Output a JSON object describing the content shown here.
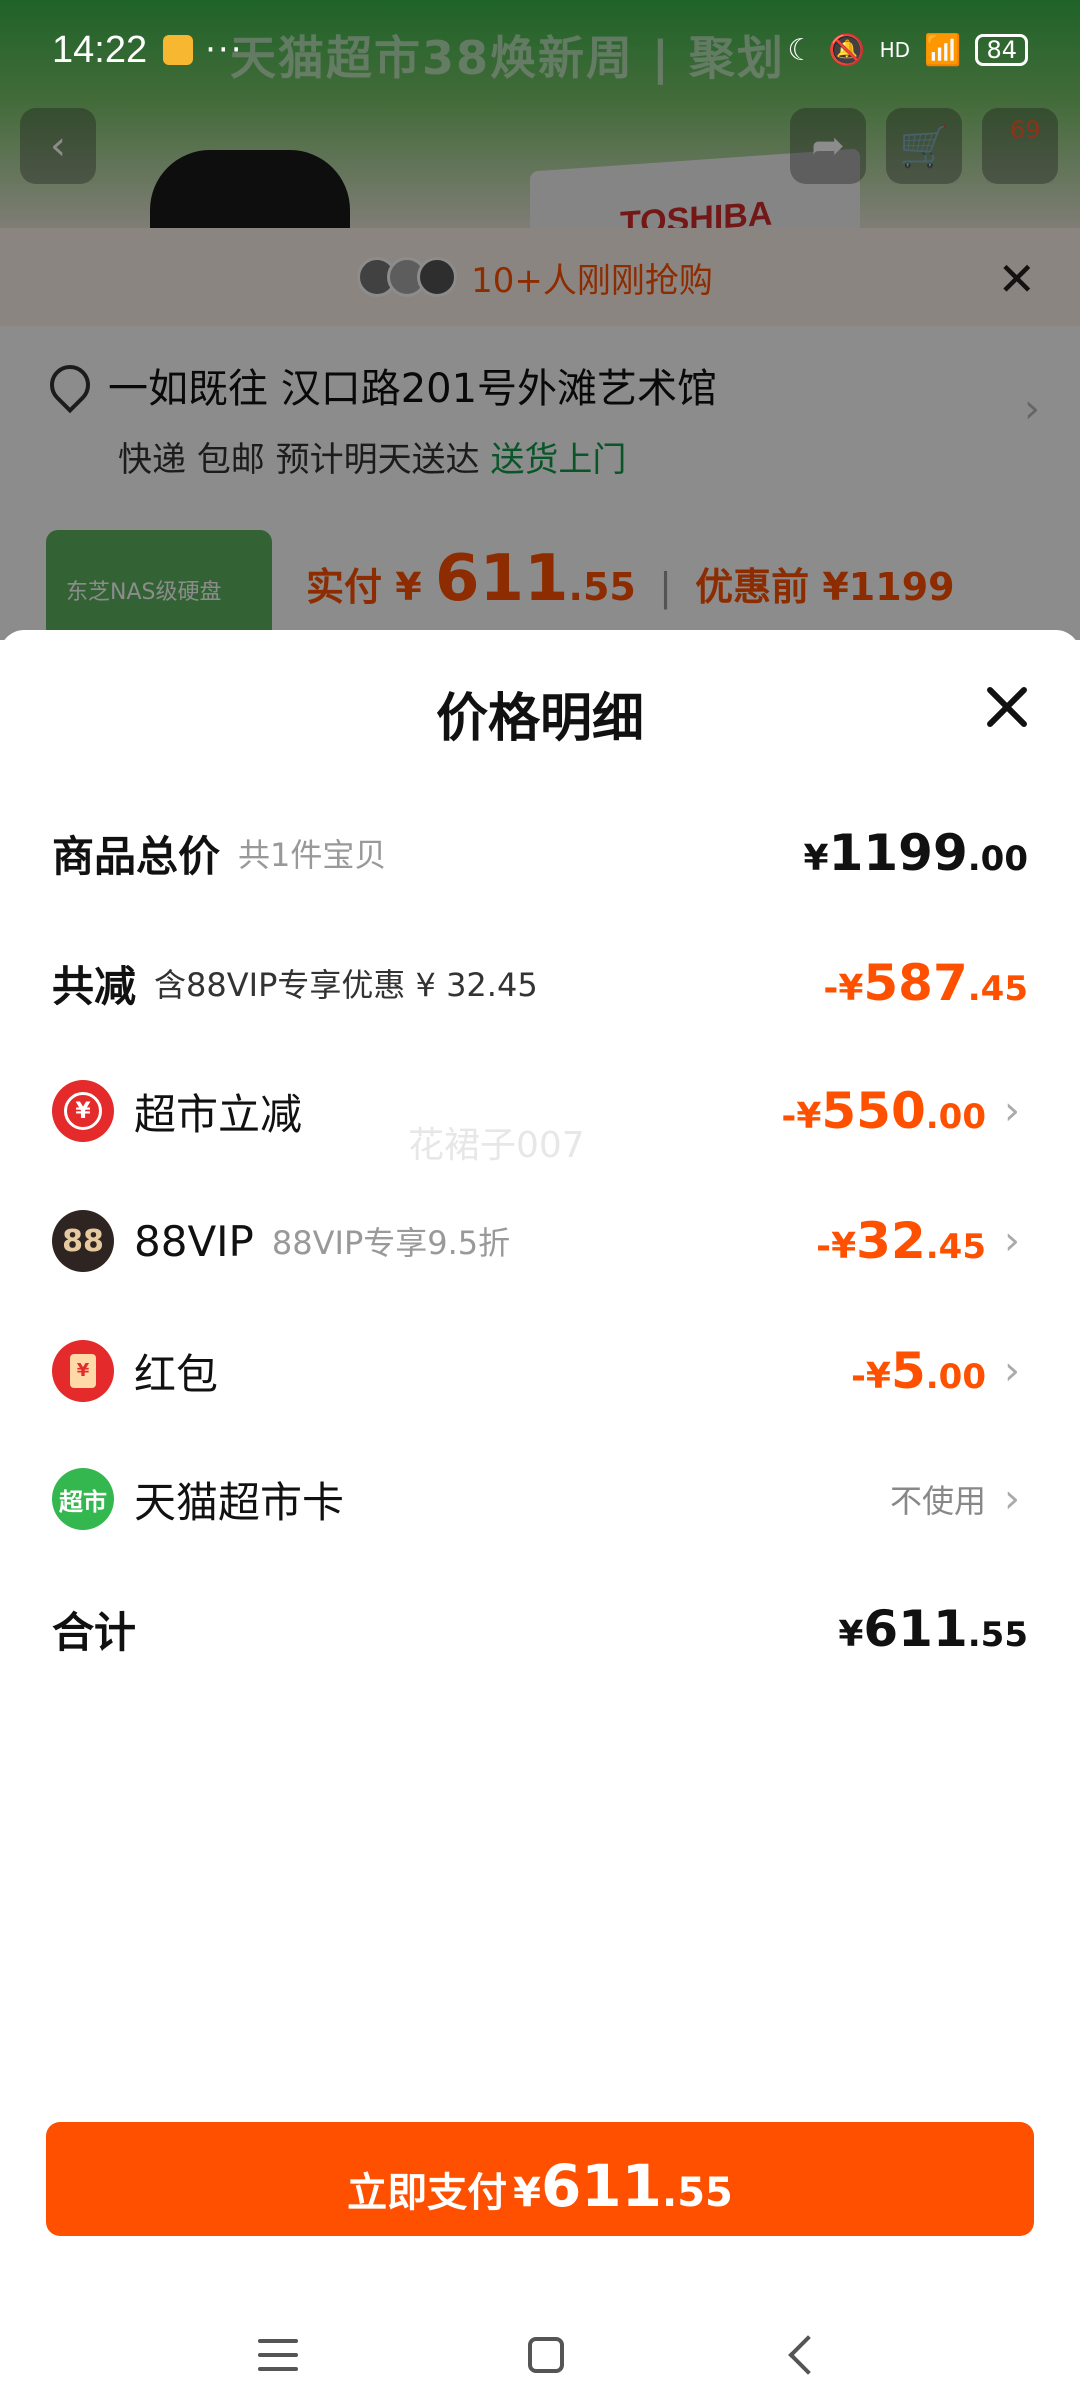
{
  "status_bar": {
    "time": "14:22",
    "signal": "HD",
    "battery": "84"
  },
  "background": {
    "banner_text": "天猫超市38焕新周 | 聚划",
    "brand_text": "TOSHIBA",
    "cart_badge": "69",
    "buyers_text": "10+人刚刚抢购",
    "address": "一如既往 汉口路201号外滩艺术馆",
    "delivery_prefix": "快递 包邮 预计明天送达",
    "delivery_highlight": "送货上门",
    "thumb_label": "东芝NAS级硬盘",
    "paid_label": "实付",
    "paid_yen": "¥",
    "paid_int": "611",
    "paid_dec": ".55",
    "before_discount": "优惠前 ¥1199"
  },
  "sheet": {
    "title": "价格明细",
    "watermark": "花裙子007",
    "rows": [
      {
        "label": "商品总价",
        "sub": "共1件宝贝",
        "yen": "¥",
        "int": "1199",
        "dec": ".00"
      },
      {
        "label": "共减",
        "sub": "含88VIP专享优惠 ¥ 32.45",
        "yen": "-¥",
        "int": "587",
        "dec": ".45"
      },
      {
        "label": "超市立减",
        "icon_text": "¥",
        "yen": "-¥",
        "int": "550",
        "dec": ".00"
      },
      {
        "label": "88VIP",
        "icon_text": "88",
        "sub": "88VIP专享9.5折",
        "yen": "-¥",
        "int": "32",
        "dec": ".45"
      },
      {
        "label": "红包",
        "icon_text": "¥",
        "yen": "-¥",
        "int": "5",
        "dec": ".00"
      },
      {
        "label": "天猫超市卡",
        "icon_text": "超市",
        "value": "不使用"
      },
      {
        "label": "合计",
        "yen": "¥",
        "int": "611",
        "dec": ".55"
      }
    ],
    "pay_button": {
      "text": "立即支付",
      "yen": "¥",
      "int": "611",
      "dec": ".55"
    }
  },
  "colors": {
    "accent": "#ff5000",
    "green": "#0f9c4a"
  }
}
